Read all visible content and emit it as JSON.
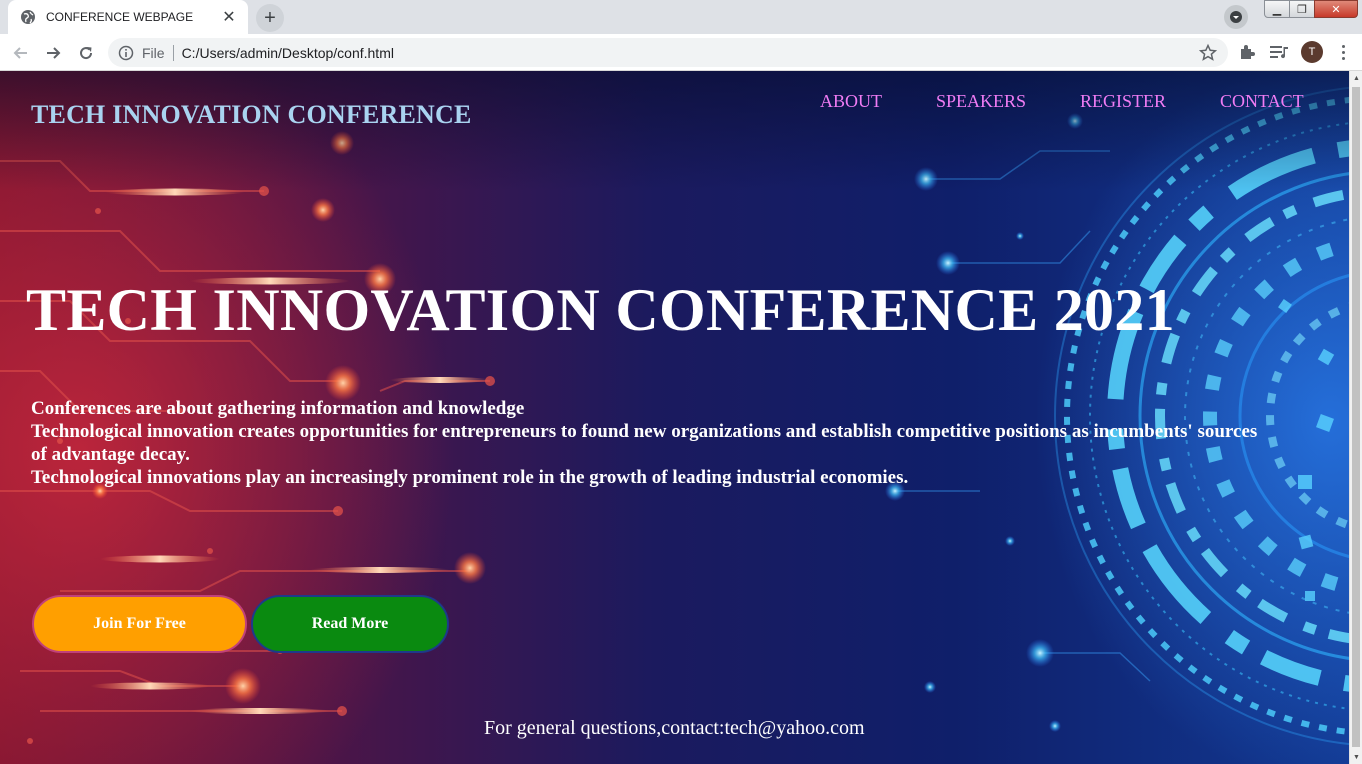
{
  "browser": {
    "tab_title": "CONFERENCE WEBPAGE",
    "tab_close": "✕",
    "new_tab": "+",
    "address_scheme_label": "File",
    "address_url": "C:/Users/admin/Desktop/conf.html",
    "profile_initial": "T",
    "window_buttons": {
      "minimize": "▁",
      "restore": "❐",
      "close": "✕"
    }
  },
  "page": {
    "brand": "TECH INNOVATION CONFERENCE",
    "nav": {
      "about": "ABOUT",
      "speakers": "SPEAKERS",
      "register": "REGISTER",
      "contact": "CONTACT"
    },
    "hero_title": "TECH INNOVATION CONFERENCE 2021",
    "hero_lines": [
      "Conferences are about gathering information and knowledge",
      "Technological innovation creates opportunities for entrepreneurs to found new organizations and establish competitive positions as incumbents' sources of advantage decay.",
      "Technological innovations play an increasingly prominent role in the growth of leading industrial economies."
    ],
    "buttons": {
      "join": "Join For Free",
      "read_more": "Read More"
    },
    "footer": "For general questions,contact:tech@yahoo.com"
  },
  "colors": {
    "brand_text": "#a9d3f0",
    "nav_link": "#f07cf4",
    "join_button": "#ff9f00",
    "read_more_button": "#0a8a10"
  },
  "icons": [
    "globe-icon",
    "close-icon",
    "plus-icon",
    "tab-search-icon",
    "back-arrow-icon",
    "forward-arrow-icon",
    "reload-icon",
    "info-icon",
    "star-icon",
    "puzzle-extension-icon",
    "media-queue-icon",
    "avatar",
    "kebab-menu-icon"
  ]
}
